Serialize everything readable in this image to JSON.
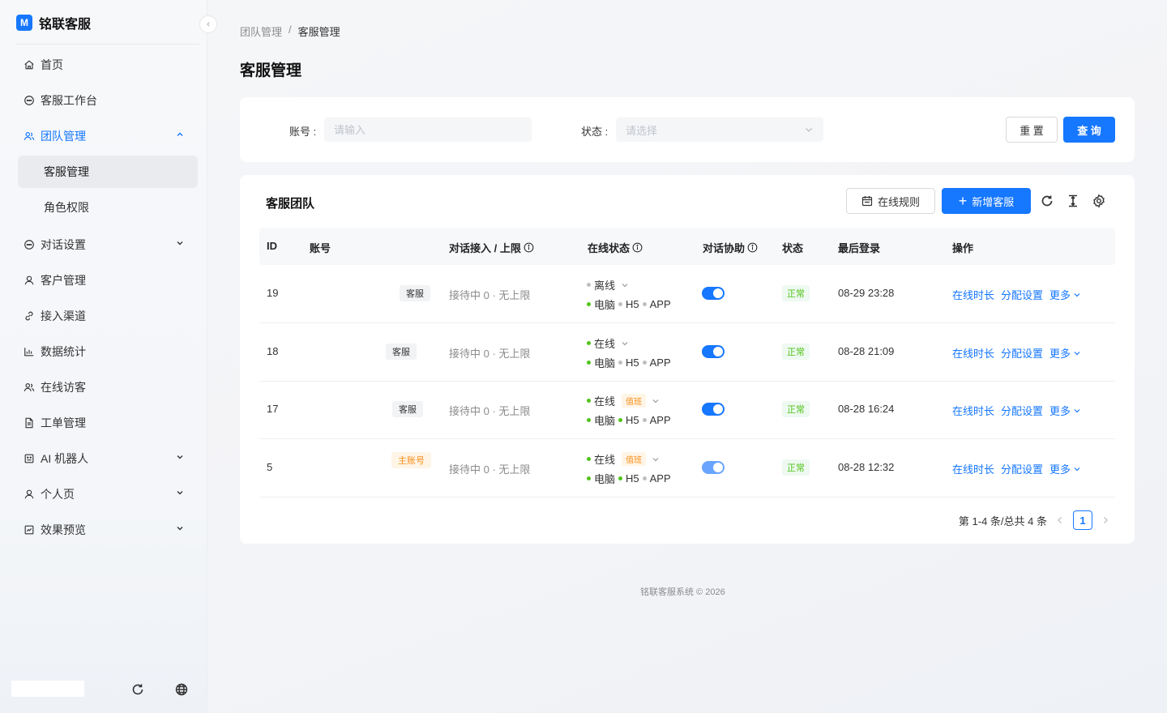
{
  "brand": {
    "logo": "M",
    "name": "铭联客服"
  },
  "menu": {
    "items": [
      {
        "label": "首页",
        "icon": "home-icon"
      },
      {
        "label": "客服工作台",
        "icon": "chat-icon"
      },
      {
        "label": "团队管理",
        "icon": "team-icon",
        "expanded": true,
        "active": true
      },
      {
        "label": "对话设置",
        "icon": "chat-icon",
        "caret": "down"
      },
      {
        "label": "客户管理",
        "icon": "user-icon"
      },
      {
        "label": "接入渠道",
        "icon": "link-icon"
      },
      {
        "label": "数据统计",
        "icon": "chart-icon"
      },
      {
        "label": "在线访客",
        "icon": "team-icon"
      },
      {
        "label": "工单管理",
        "icon": "file-icon"
      },
      {
        "label": "AI 机器人",
        "icon": "robot-icon",
        "caret": "down"
      },
      {
        "label": "个人页",
        "icon": "user-icon",
        "caret": "down"
      },
      {
        "label": "效果预览",
        "icon": "preview-icon",
        "caret": "down"
      }
    ],
    "submenu": [
      {
        "label": "客服管理",
        "selected": true
      },
      {
        "label": "角色权限"
      }
    ]
  },
  "breadcrumb": {
    "parent": "团队管理",
    "separator": "/",
    "current": "客服管理"
  },
  "page_title": "客服管理",
  "search": {
    "account_label": "账号 :",
    "account_placeholder": "请输入",
    "status_label": "状态 :",
    "status_placeholder": "请选择",
    "reset_label": "重 置",
    "query_label": "查 询"
  },
  "table": {
    "title": "客服团队",
    "online_rules_label": "在线规则",
    "add_label": "新增客服",
    "columns": [
      "ID",
      "账号",
      "对话接入 / 上限",
      "在线状态",
      "对话协助",
      "状态",
      "最后登录",
      "操作"
    ],
    "rows": [
      {
        "id": "19",
        "role": "客服",
        "role_style": "gray",
        "capacity": "接待中 0 · 无上限",
        "online": "离线",
        "online_dot": "gray",
        "shift": "",
        "devices": [
          "电脑",
          "H5",
          "APP"
        ],
        "device_dots": [
          "gray",
          "gray"
        ],
        "assist_on": true,
        "status": "正常",
        "last_login": "08-29 23:28"
      },
      {
        "id": "18",
        "role": "客服",
        "role_style": "gray",
        "capacity": "接待中 0 · 无上限",
        "online": "在线",
        "online_dot": "green",
        "shift": "",
        "devices": [
          "电脑",
          "H5",
          "APP"
        ],
        "device_dots": [
          "gray",
          "gray"
        ],
        "assist_on": true,
        "status": "正常",
        "last_login": "08-28 21:09"
      },
      {
        "id": "17",
        "role": "客服",
        "role_style": "gray",
        "capacity": "接待中 0 · 无上限",
        "online": "在线",
        "online_dot": "green",
        "shift": "值班",
        "devices": [
          "电脑",
          "H5",
          "APP"
        ],
        "device_dots": [
          "green",
          "gray"
        ],
        "assist_on": true,
        "status": "正常",
        "last_login": "08-28 16:24"
      },
      {
        "id": "5",
        "role": "主账号",
        "role_style": "orange",
        "capacity": "接待中 0 · 无上限",
        "online": "在线",
        "online_dot": "green",
        "shift": "值班",
        "devices": [
          "电脑",
          "H5",
          "APP"
        ],
        "device_dots": [
          "green",
          "gray"
        ],
        "assist_on": true,
        "assist_dim": true,
        "status": "正常",
        "last_login": "08-28 12:32"
      }
    ],
    "actions": [
      "在线时长",
      "分配设置",
      "更多"
    ]
  },
  "pagination": {
    "summary": "第 1-4 条/总共 4 条",
    "current_page": "1"
  },
  "footer": "铭联客服系统 © 2026",
  "colors": {
    "primary": "#1677ff",
    "success": "#52c41a",
    "warning": "#fa8c16"
  }
}
